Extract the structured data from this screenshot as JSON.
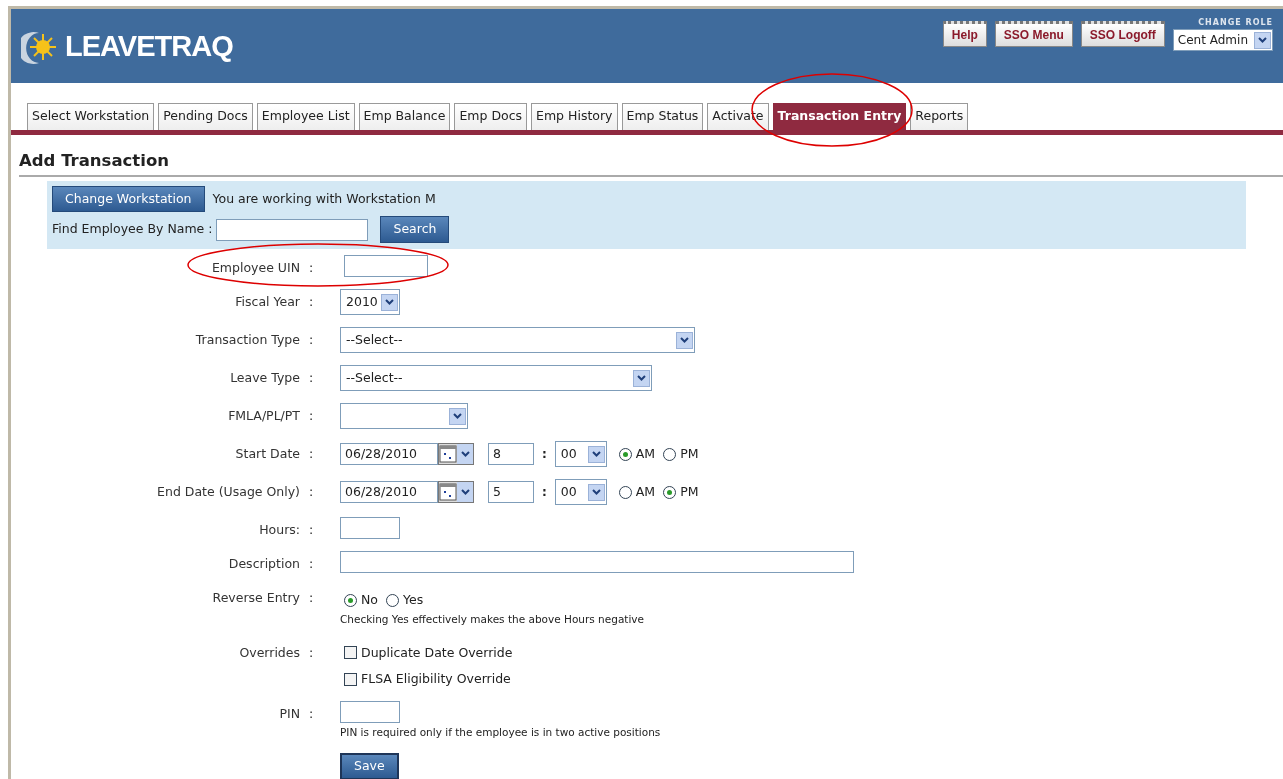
{
  "header": {
    "logo": "LEAVETRAQ",
    "buttons": [
      "Help",
      "SSO Menu",
      "SSO Logoff"
    ],
    "role_label": "CHANGE ROLE",
    "role_value": "Cent Admin"
  },
  "tabs": [
    {
      "label": "Select Workstation",
      "selected": false,
      "circled": false
    },
    {
      "label": "Pending Docs",
      "selected": false,
      "circled": false
    },
    {
      "label": "Employee List",
      "selected": false,
      "circled": false
    },
    {
      "label": "Emp Balance",
      "selected": false,
      "circled": false
    },
    {
      "label": "Emp Docs",
      "selected": false,
      "circled": false
    },
    {
      "label": "Emp History",
      "selected": false,
      "circled": false
    },
    {
      "label": "Emp Status",
      "selected": false,
      "circled": false
    },
    {
      "label": "Activate",
      "selected": false,
      "circled": false
    },
    {
      "label": "Transaction Entry",
      "selected": true,
      "circled": true
    },
    {
      "label": "Reports",
      "selected": false,
      "circled": false
    }
  ],
  "page_title": "Add Transaction",
  "workstation_panel": {
    "button": "Change Workstation",
    "message": "You are working with Workstation M",
    "find_label": "Find Employee By Name :",
    "search_button": "Search"
  },
  "form": [
    {
      "kind": "text",
      "label": "Employee UIN",
      "circled": true
    },
    {
      "kind": "select",
      "label": "Fiscal Year",
      "value": "2010",
      "circled": false
    },
    {
      "kind": "select",
      "label": "Transaction Type",
      "value": "--Select--",
      "circled": false
    },
    {
      "kind": "select",
      "label": "Leave Type",
      "value": "--Select--",
      "circled": false
    },
    {
      "kind": "select",
      "label": "FMLA/PL/PT",
      "circled": false
    },
    {
      "kind": "datetime",
      "label": "Start Date",
      "date": "06/28/2010",
      "hour": "8",
      "minute": "00",
      "periods": [
        {
          "label": "AM",
          "selected": true
        },
        {
          "label": "PM",
          "selected": false
        }
      ],
      "circled": false
    },
    {
      "kind": "datetime",
      "label": "End Date (Usage Only)",
      "date": "06/28/2010",
      "hour": "5",
      "minute": "00",
      "periods": [
        {
          "label": "AM",
          "selected": false
        },
        {
          "label": "PM",
          "selected": true
        }
      ],
      "circled": false
    },
    {
      "kind": "text",
      "label": "Hours:",
      "circled": false
    },
    {
      "kind": "text",
      "label": "Description",
      "circled": false
    },
    {
      "kind": "radio",
      "label": "Reverse Entry",
      "options": [
        {
          "label": "No",
          "selected": true
        },
        {
          "label": "Yes",
          "selected": false
        }
      ],
      "note": "Checking Yes effectively makes the above Hours negative",
      "circled": false
    },
    {
      "kind": "checks",
      "label": "Overrides",
      "options": [
        {
          "label": "Duplicate Date Override",
          "checked": false
        },
        {
          "label": "FLSA Eligibility Override",
          "checked": false
        }
      ],
      "circled": false
    },
    {
      "kind": "text",
      "label": "PIN",
      "note": "PIN is required only if the employee is in two active positions",
      "circled": false
    }
  ],
  "colon": ":",
  "save_button": "Save"
}
